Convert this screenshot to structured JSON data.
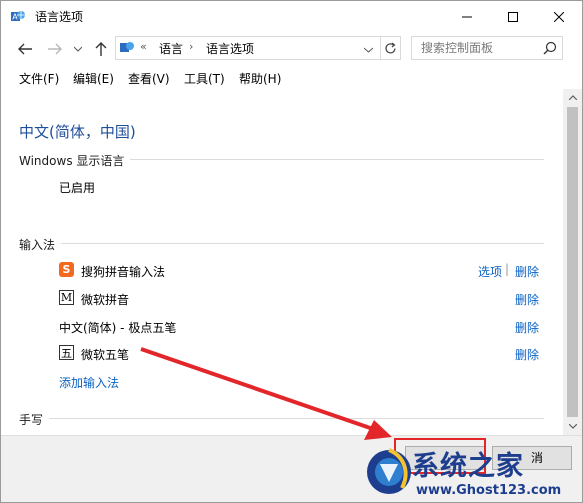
{
  "window": {
    "title": "语言选项"
  },
  "toolbar": {
    "breadcrumb": [
      "语言",
      "语言选项"
    ],
    "search_placeholder": "搜索控制面板"
  },
  "menu": [
    {
      "label": "文件(F)"
    },
    {
      "label": "编辑(E)"
    },
    {
      "label": "查看(V)"
    },
    {
      "label": "工具(T)"
    },
    {
      "label": "帮助(H)"
    }
  ],
  "content": {
    "heading": "中文(简体，中国)",
    "display_language": {
      "title": "Windows 显示语言",
      "status": "已启用"
    },
    "input_methods": {
      "title": "输入法",
      "items": [
        {
          "name": "搜狗拼音输入法",
          "icon": "sogou-icon",
          "actions": [
            "选项",
            "删除"
          ]
        },
        {
          "name": "微软拼音",
          "icon": "m-icon",
          "actions": [
            "删除"
          ]
        },
        {
          "name": "中文(简体) - 极点五笔",
          "icon": "",
          "actions": [
            "删除"
          ]
        },
        {
          "name": "微软五笔",
          "icon": "wubi-icon",
          "actions": [
            "删除"
          ]
        }
      ],
      "add_link": "添加输入法"
    },
    "handwriting": {
      "title": "手写"
    }
  },
  "footer": {
    "save_label": "消"
  },
  "watermark": {
    "title": "系统之家",
    "url": "www.Ghost123.com"
  },
  "colors": {
    "link": "#0a62c4",
    "heading": "#1e4e9a",
    "highlight": "#e2262a",
    "arrow": "#e2262a"
  }
}
